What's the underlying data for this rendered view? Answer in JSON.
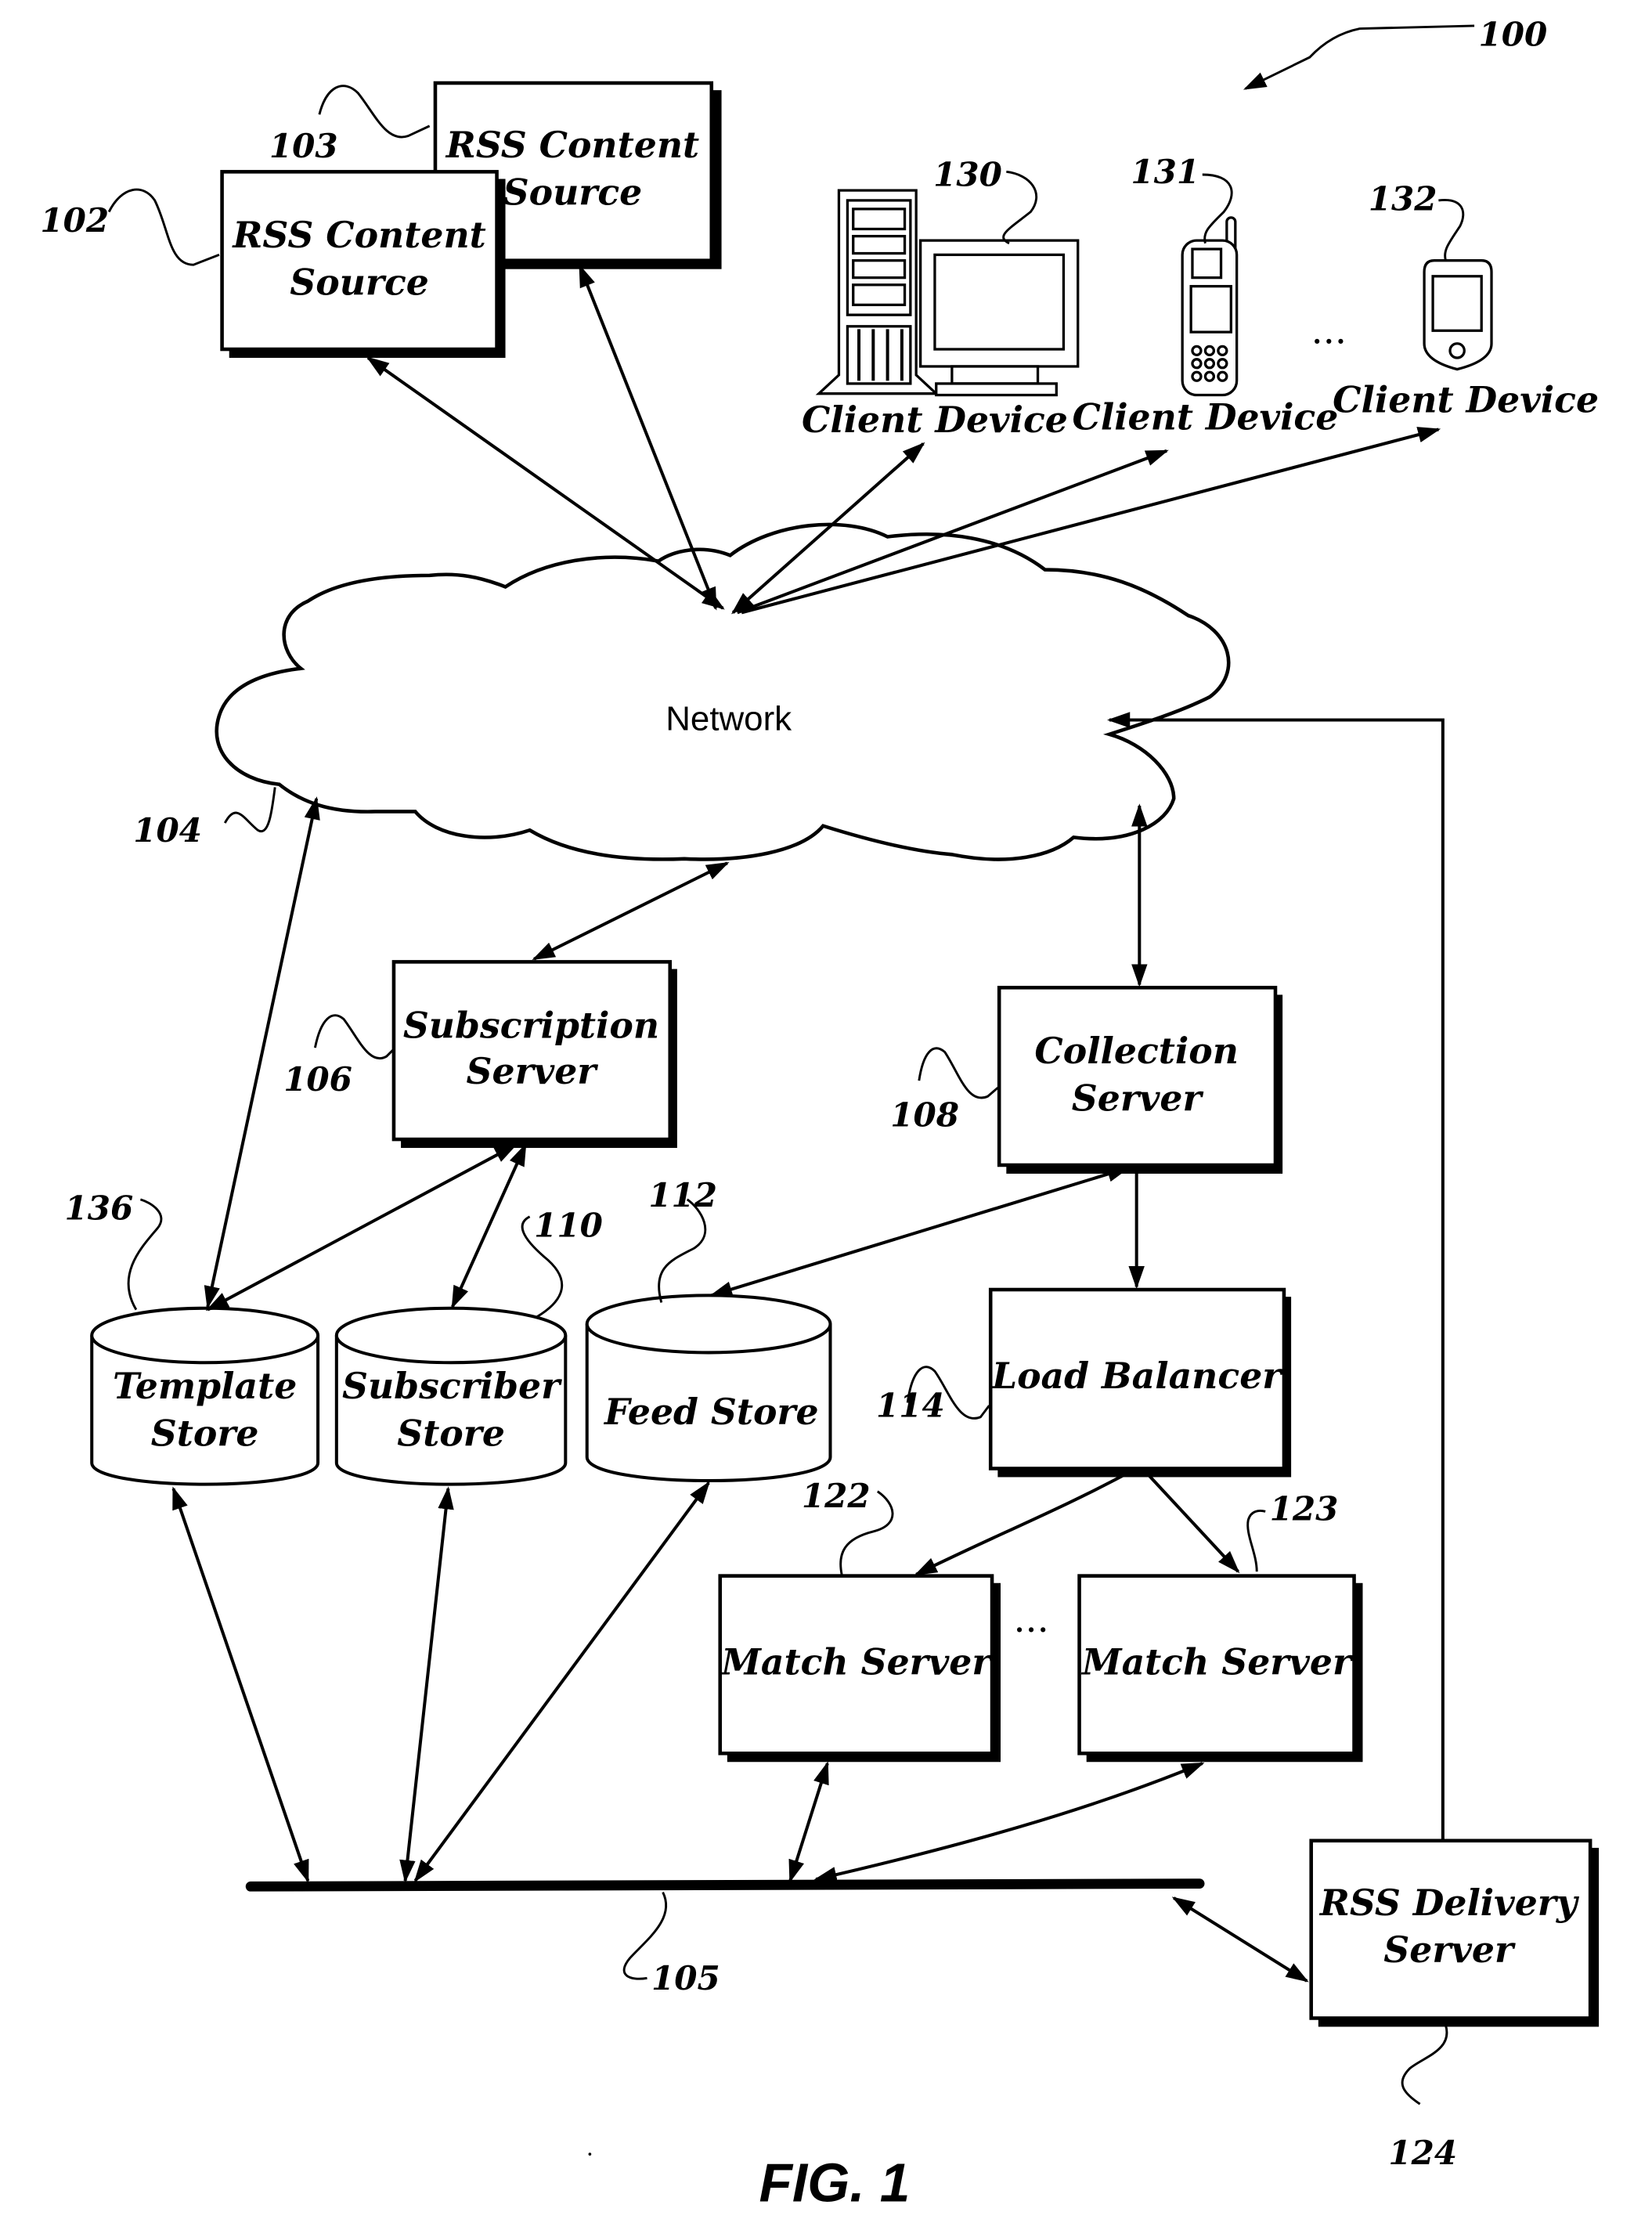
{
  "figure": {
    "title": "FIG. 1",
    "system_ref": "100"
  },
  "content_sources": [
    {
      "ref": "102",
      "line1": "RSS Content",
      "line2": "Source"
    },
    {
      "ref": "103",
      "line1": "RSS Content",
      "line2": "Source"
    }
  ],
  "client_devices": [
    {
      "ref": "130",
      "label": "Client Device",
      "icon": "desktop-computer-icon"
    },
    {
      "ref": "131",
      "label": "Client Device",
      "icon": "mobile-phone-icon"
    },
    {
      "ref": "132",
      "label": "Client Device",
      "icon": "pda-icon"
    }
  ],
  "ellipsis": "...",
  "network": {
    "ref": "104",
    "label": "Network"
  },
  "subscription_server": {
    "ref": "106",
    "line1": "Subscription",
    "line2": "Server"
  },
  "collection_server": {
    "ref": "108",
    "line1": "Collection",
    "line2": "Server"
  },
  "load_balancer": {
    "ref": "114",
    "label": "Load Balancer"
  },
  "stores": [
    {
      "ref": "136",
      "line1": "Template",
      "line2": "Store"
    },
    {
      "ref": "110",
      "line1": "Subscriber",
      "line2": "Store"
    },
    {
      "ref": "112",
      "line1": "Feed Store",
      "line2": ""
    }
  ],
  "match_servers": [
    {
      "ref": "122",
      "label": "Match Server"
    },
    {
      "ref": "123",
      "label": "Match Server"
    }
  ],
  "bus": {
    "ref": "105"
  },
  "delivery_server": {
    "ref": "124",
    "line1": "RSS Delivery",
    "line2": "Server"
  }
}
